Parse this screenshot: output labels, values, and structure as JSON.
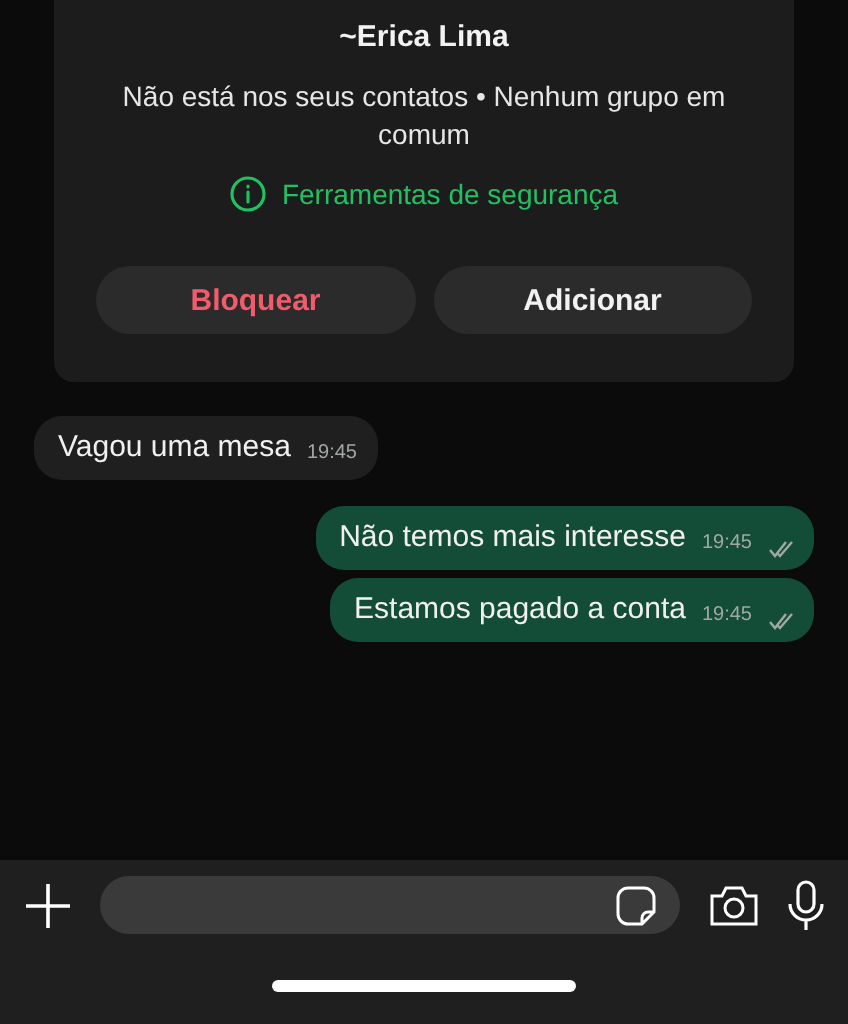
{
  "contact_card": {
    "name": "~Erica Lima",
    "info": "Não está nos seus contatos • Nenhum grupo em comum",
    "safety_link": "Ferramentas de segurança",
    "buttons": [
      {
        "label": "Bloquear",
        "kind": "danger"
      },
      {
        "label": "Adicionar",
        "kind": "normal"
      }
    ]
  },
  "messages": [
    {
      "text": "Vagou uma mesa",
      "time": "19:45",
      "kind": "received"
    },
    {
      "text": "Não temos mais interesse",
      "time": "19:45",
      "kind": "sent",
      "read": false
    },
    {
      "text": "Estamos pagado a conta",
      "time": "19:45",
      "kind": "sent",
      "read": false
    }
  ],
  "composer": {
    "kind": "empty"
  }
}
